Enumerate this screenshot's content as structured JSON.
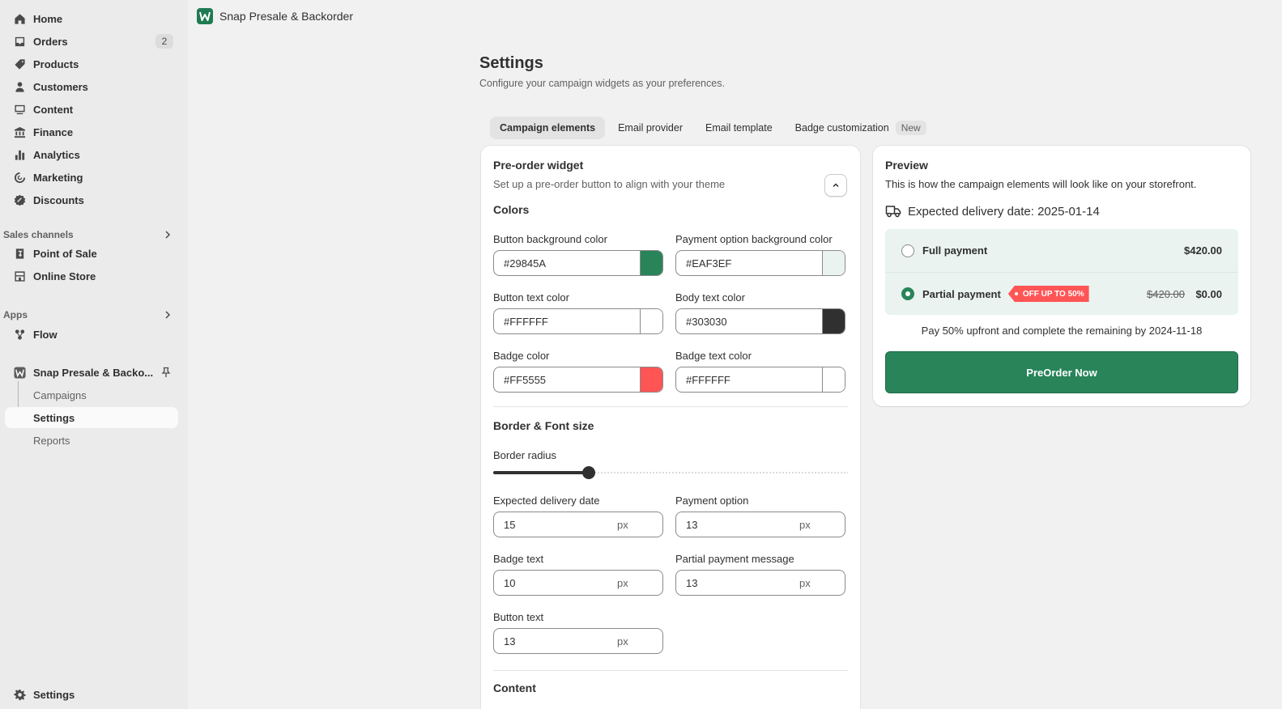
{
  "sidebar": {
    "main_items": [
      {
        "label": "Home",
        "icon": "home-icon"
      },
      {
        "label": "Orders",
        "icon": "orders-icon",
        "count": "2"
      },
      {
        "label": "Products",
        "icon": "tag-icon"
      },
      {
        "label": "Customers",
        "icon": "person-icon"
      },
      {
        "label": "Content",
        "icon": "content-icon"
      },
      {
        "label": "Finance",
        "icon": "bank-icon"
      },
      {
        "label": "Analytics",
        "icon": "bar-chart-icon"
      },
      {
        "label": "Marketing",
        "icon": "target-icon"
      },
      {
        "label": "Discounts",
        "icon": "discount-icon"
      }
    ],
    "sales_channels": {
      "label": "Sales channels",
      "items": [
        {
          "label": "Point of Sale",
          "icon": "pos-icon"
        },
        {
          "label": "Online Store",
          "icon": "store-icon"
        }
      ]
    },
    "apps": {
      "label": "Apps",
      "items": [
        {
          "label": "Flow",
          "icon": "flow-icon"
        }
      ]
    },
    "pinned_app": {
      "label": "Snap Presale & Backo...",
      "sub_items": [
        "Campaigns",
        "Settings",
        "Reports"
      ]
    },
    "settings_label": "Settings"
  },
  "topbar": {
    "app_title": "Snap Presale & Backorder"
  },
  "page": {
    "title": "Settings",
    "subtitle": "Configure your campaign widgets as your preferences."
  },
  "tabs": [
    {
      "label": "Campaign elements",
      "active": true
    },
    {
      "label": "Email provider"
    },
    {
      "label": "Email template"
    },
    {
      "label": "Badge customization",
      "pill": "New"
    }
  ],
  "widget": {
    "title": "Pre-order widget",
    "description": "Set up a pre-order button to align with your theme",
    "colors_heading": "Colors",
    "colors": {
      "button_bg": {
        "label": "Button background color",
        "value": "#29845A"
      },
      "payment_bg": {
        "label": "Payment option background color",
        "value": "#EAF3EF"
      },
      "button_text": {
        "label": "Button text color",
        "value": "#FFFFFF"
      },
      "body_text": {
        "label": "Body text color",
        "value": "#303030"
      },
      "badge": {
        "label": "Badge color",
        "value": "#FF5555"
      },
      "badge_text": {
        "label": "Badge text color",
        "value": "#FFFFFF"
      }
    },
    "border_heading": "Border & Font size",
    "border_radius": {
      "label": "Border radius",
      "percent": 27
    },
    "sizes": {
      "delivery": {
        "label": "Expected delivery date",
        "value": "15",
        "unit": "px"
      },
      "payment": {
        "label": "Payment option",
        "value": "13",
        "unit": "px"
      },
      "badge_text": {
        "label": "Badge text",
        "value": "10",
        "unit": "px"
      },
      "partial_msg": {
        "label": "Partial payment message",
        "value": "13",
        "unit": "px"
      },
      "button_text": {
        "label": "Button text",
        "value": "13",
        "unit": "px"
      }
    },
    "content_heading": "Content"
  },
  "preview": {
    "title": "Preview",
    "description": "This is how the campaign elements will look like on your storefront.",
    "delivery": "Expected delivery date: 2025-01-14",
    "full_payment": {
      "label": "Full payment",
      "price": "$420.00"
    },
    "partial_payment": {
      "label": "Partial payment",
      "badge": "OFF UP TO 50%",
      "original_price": "$420.00",
      "price": "$0.00"
    },
    "partial_message": "Pay 50% upfront and complete the remaining by 2024-11-18",
    "button_label": "PreOrder Now"
  }
}
